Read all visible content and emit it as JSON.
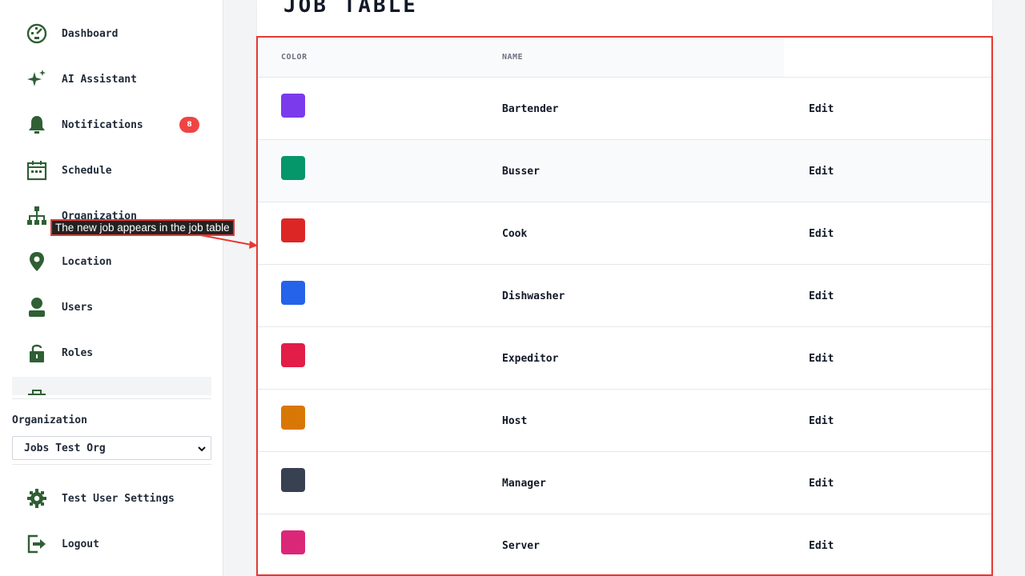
{
  "sidebar": {
    "items": [
      {
        "label": "Dashboard",
        "icon": "dashboard-icon"
      },
      {
        "label": "AI Assistant",
        "icon": "sparkle-icon"
      },
      {
        "label": "Notifications",
        "icon": "bell-icon",
        "badge": "8"
      },
      {
        "label": "Schedule",
        "icon": "calendar-icon"
      },
      {
        "label": "Organization",
        "icon": "org-chart-icon"
      },
      {
        "label": "Location",
        "icon": "location-pin-icon"
      },
      {
        "label": "Users",
        "icon": "user-icon"
      },
      {
        "label": "Roles",
        "icon": "lock-icon"
      }
    ],
    "partial_item_icon": "briefcase-icon",
    "organization_label": "Organization",
    "organization_value": "Jobs Test Org",
    "bottom": [
      {
        "label": "Test User Settings",
        "icon": "gear-icon"
      },
      {
        "label": "Logout",
        "icon": "logout-icon"
      }
    ]
  },
  "main": {
    "title": "JOB TABLE",
    "columns": {
      "color": "COLOR",
      "name": "NAME"
    },
    "jobs": [
      {
        "name": "Bartender",
        "color": "#7c3aed",
        "action": "Edit"
      },
      {
        "name": "Busser",
        "color": "#059669",
        "action": "Edit"
      },
      {
        "name": "Cook",
        "color": "#dc2626",
        "action": "Edit"
      },
      {
        "name": "Dishwasher",
        "color": "#2563eb",
        "action": "Edit"
      },
      {
        "name": "Expeditor",
        "color": "#e11d48",
        "action": "Edit"
      },
      {
        "name": "Host",
        "color": "#d97706",
        "action": "Edit"
      },
      {
        "name": "Manager",
        "color": "#374151",
        "action": "Edit"
      },
      {
        "name": "Server",
        "color": "#db2777",
        "action": "Edit"
      }
    ]
  },
  "annotation": {
    "text": "The new job appears in the job table"
  },
  "colors": {
    "accent": "#2f5f34",
    "badge": "#ef4444",
    "highlight": "#e53935"
  }
}
